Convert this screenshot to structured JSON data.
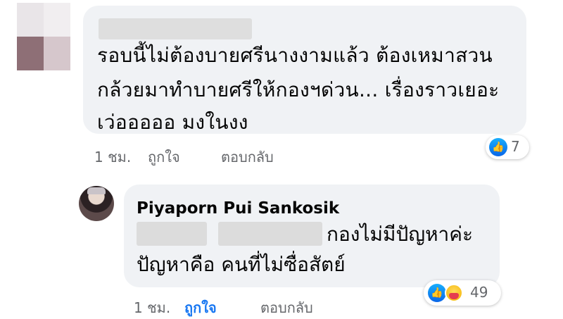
{
  "comment1": {
    "lines": [
      "รอบนี้ไม่ต้องบายศรีนางงามแล้ว ต้องเหมาสวน",
      "กล้วยมาทำบายศรีให้กองฯด่วน... เรื่องราวเยอะ",
      "เว่อออออ มงในงง"
    ],
    "time": "1 ชม.",
    "like_label": "ถูกใจ",
    "reply_label": "ตอบกลับ",
    "reaction_count": "7",
    "reaction_icons": [
      "like-icon"
    ]
  },
  "reply": {
    "author": "Piyaporn Pui Sankosik",
    "lines": [
      "กองไม่มีปัญหาค่ะ",
      "ปัญหาคือ คนที่ไม่ซื่อสัตย์"
    ],
    "time": "1 ชม.",
    "like_label": "ถูกใจ",
    "reply_label": "ตอบกลับ",
    "reaction_count": "49",
    "reaction_icons": [
      "like-icon",
      "care-icon"
    ]
  },
  "colors": {
    "bubble": "#f0f2f5",
    "meta_text": "#65676b",
    "liked": "#1877f2"
  }
}
